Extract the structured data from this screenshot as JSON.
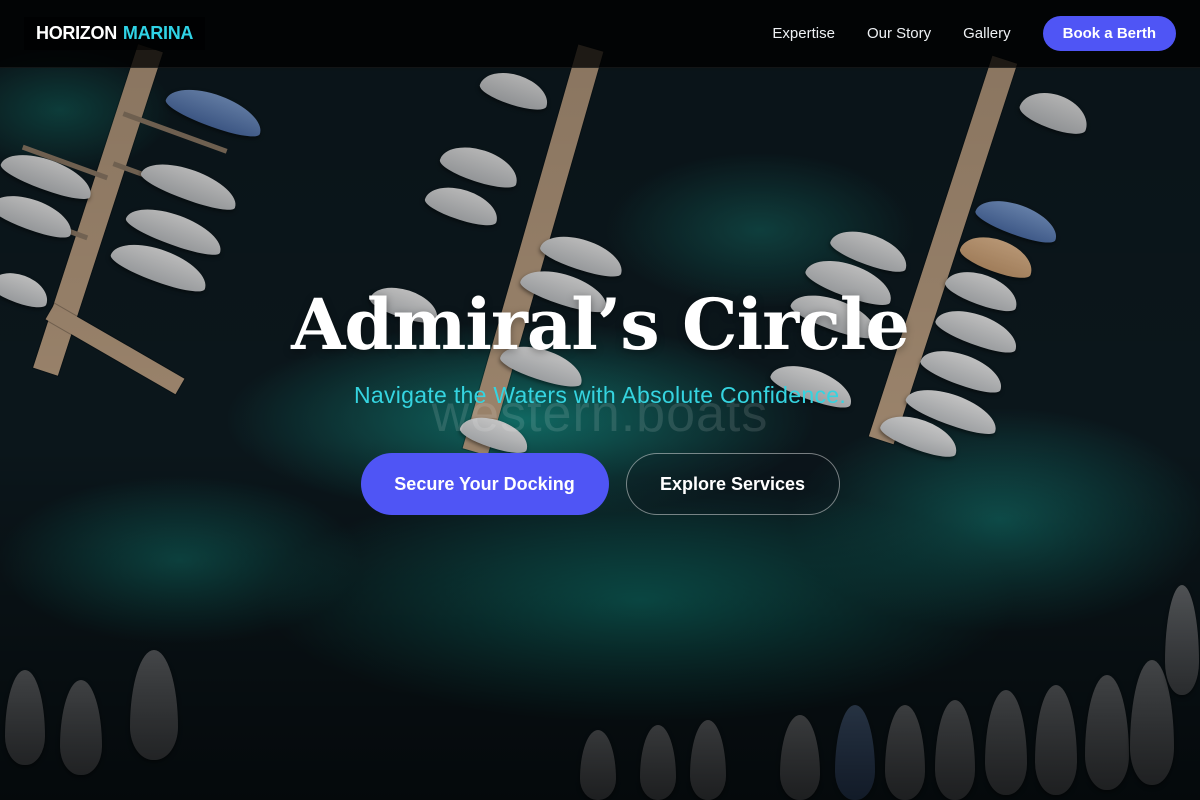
{
  "nav": {
    "brand_primary": "HORIZON",
    "brand_accent": "MARINA",
    "links": [
      {
        "label": "Expertise"
      },
      {
        "label": "Our Story"
      },
      {
        "label": "Gallery"
      }
    ],
    "cta_label": "Book a Berth"
  },
  "hero": {
    "title": "Admiral’s Circle",
    "subtitle": "Navigate the Waters with Absolute Confidence.",
    "watermark": "western.boats",
    "primary_button": "Secure Your Docking",
    "secondary_button": "Explore Services"
  },
  "colors": {
    "accent_primary": "#4f55f5",
    "accent_cyan": "#2fd3e6",
    "nav_background": "#000000"
  }
}
